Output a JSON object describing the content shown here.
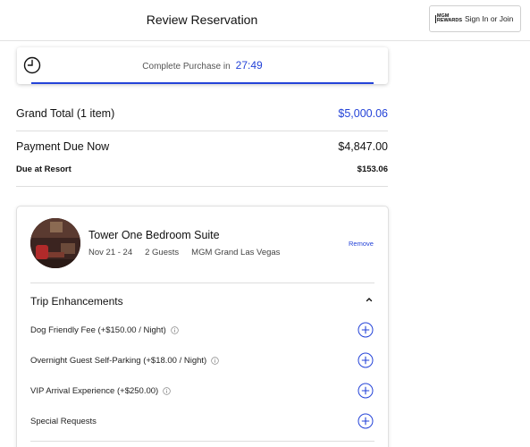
{
  "header": {
    "title": "Review Reservation",
    "logo_text": "MGM REWARDS",
    "signin_label": "Sign In or Join"
  },
  "timer": {
    "label": "Complete Purchase in",
    "countdown": "27:49"
  },
  "totals": {
    "grand_total_label": "Grand Total (1 item)",
    "grand_total_value": "$5,000.06",
    "payment_due_label": "Payment Due Now",
    "payment_due_value": "$4,847.00",
    "due_resort_label": "Due at Resort",
    "due_resort_value": "$153.06"
  },
  "room": {
    "title": "Tower One Bedroom Suite",
    "dates": "Nov 21 - 24",
    "guests": "2 Guests",
    "property": "MGM Grand Las Vegas",
    "remove_label": "Remove"
  },
  "enhancements": {
    "title": "Trip Enhancements",
    "items": [
      {
        "label": "Dog Friendly Fee (+$150.00 / Night)",
        "has_info": true
      },
      {
        "label": "Overnight Guest Self-Parking (+$18.00 / Night)",
        "has_info": true
      },
      {
        "label": "VIP Arrival Experience (+$250.00)",
        "has_info": true
      },
      {
        "label": "Special Requests",
        "has_info": false
      }
    ]
  },
  "colors": {
    "accent": "#2443d8",
    "divider": "#dedede",
    "text": "#111111"
  },
  "icons": {
    "timer": "clock-icon",
    "collapse": "chevron-up-icon",
    "info": "info-icon",
    "add": "plus-circle-icon"
  }
}
